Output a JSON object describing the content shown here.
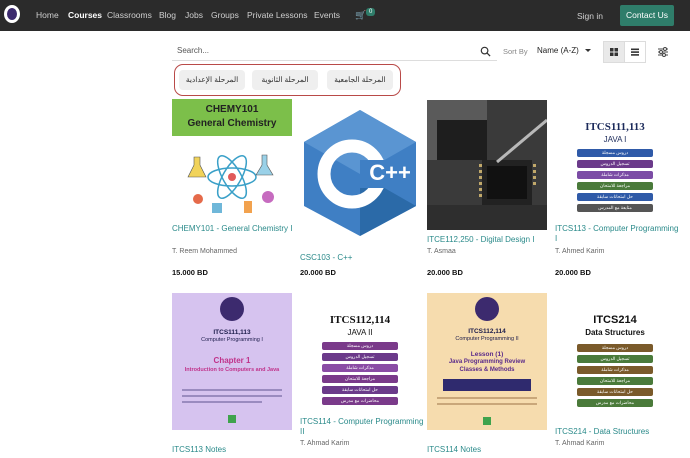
{
  "nav": {
    "items": [
      "Home",
      "Courses",
      "Classrooms",
      "Blog",
      "Jobs",
      "Groups",
      "Private Lessons",
      "Events"
    ],
    "active": "Courses",
    "cart_count": "0",
    "sign_in": "Sign in",
    "contact": "Contact Us"
  },
  "toolbar": {
    "search_placeholder": "Search...",
    "sort_label": "Sort By",
    "sort_value": "Name (A-Z)"
  },
  "categories": [
    "المرحلة الجامعية",
    "المرحلة الثانوية",
    "المرحلة الإعدادية"
  ],
  "courses": [
    {
      "title": "CHEMY101 - General Chemistry I",
      "teacher": "T. Reem Mohammed",
      "price": "15.000 BD",
      "cover_line1": "CHEMY101",
      "cover_line2": "General Chemistry"
    },
    {
      "title": "CSC103 - C++",
      "teacher": "",
      "price": "20.000 BD",
      "cover_line1": "C++"
    },
    {
      "title": "ITCE112,250 - Digital Design I",
      "teacher": "T. Asmaa",
      "price": "20.000 BD"
    },
    {
      "title": "ITCS113 - Computer Programming I",
      "teacher": "T. Ahmed Karim",
      "price": "20.000 BD",
      "cover_line1": "ITCS111,113",
      "cover_line2": "JAVA I"
    },
    {
      "title": "ITCS113 Notes",
      "teacher": "",
      "price": "",
      "cover_line1": "ITCS111,113",
      "cover_line2": "Computer Programming I",
      "cover_line3": "Chapter 1",
      "cover_line4": "Introduction to Computers and Java"
    },
    {
      "title": "ITCS114 - Computer Programming II",
      "teacher": "T. Ahmad Karim",
      "price": "",
      "cover_line1": "ITCS112,114",
      "cover_line2": "JAVA II"
    },
    {
      "title": "ITCS114 Notes",
      "teacher": "",
      "price": "",
      "cover_line1": "ITCS112,114",
      "cover_line2": "Computer Programming II",
      "cover_line3": "Lesson (1)",
      "cover_line4": "Java Programming Review",
      "cover_line5": "Classes & Methods"
    },
    {
      "title": "ITCS214 - Data Structures",
      "teacher": "T. Ahmad Karim",
      "price": "",
      "cover_line1": "ITCS214",
      "cover_line2": "Data Structures"
    }
  ],
  "colors": {
    "accent": "#2f7d6a",
    "link": "#2a8a8a",
    "topbar": "#2b2b2b"
  }
}
